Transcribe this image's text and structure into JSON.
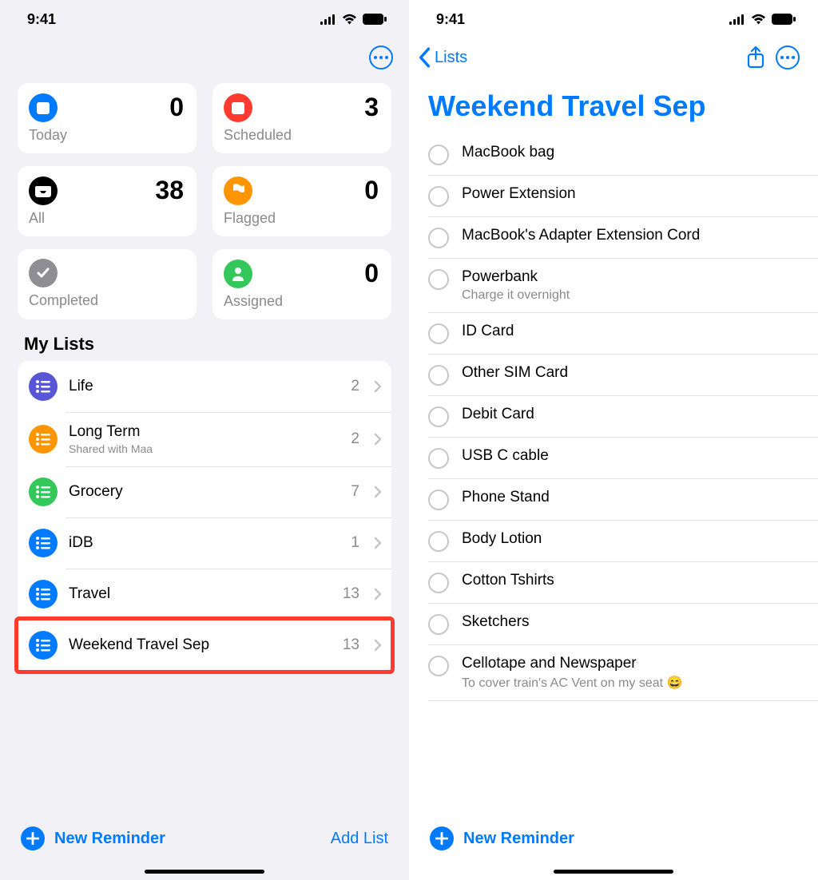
{
  "status": {
    "time": "9:41"
  },
  "left": {
    "cards": [
      {
        "label": "Today",
        "count": 0,
        "color": "#007aff",
        "icon": "calendar-icon"
      },
      {
        "label": "Scheduled",
        "count": 3,
        "color": "#ff3b30",
        "icon": "calendar-icon"
      },
      {
        "label": "All",
        "count": 38,
        "color": "#000000",
        "icon": "inbox-icon"
      },
      {
        "label": "Flagged",
        "count": 0,
        "color": "#ff9500",
        "icon": "flag-icon"
      },
      {
        "label": "Completed",
        "count": "",
        "color": "#8e8e93",
        "icon": "check-icon"
      },
      {
        "label": "Assigned",
        "count": 0,
        "color": "#34c759",
        "icon": "person-icon"
      }
    ],
    "section": "My Lists",
    "lists": [
      {
        "title": "Life",
        "subtitle": "",
        "count": 2,
        "color": "#5856d6"
      },
      {
        "title": "Long Term",
        "subtitle": "Shared with Maa",
        "count": 2,
        "color": "#ff9500"
      },
      {
        "title": "Grocery",
        "subtitle": "",
        "count": 7,
        "color": "#34c759"
      },
      {
        "title": "iDB",
        "subtitle": "",
        "count": 1,
        "color": "#007aff"
      },
      {
        "title": "Travel",
        "subtitle": "",
        "count": 13,
        "color": "#007aff"
      },
      {
        "title": "Weekend Travel Sep",
        "subtitle": "",
        "count": 13,
        "color": "#007aff"
      }
    ],
    "highlight_index": 5,
    "new_reminder": "New Reminder",
    "add_list": "Add List"
  },
  "right": {
    "back_label": "Lists",
    "title": "Weekend Travel Sep",
    "items": [
      {
        "title": "MacBook bag",
        "note": ""
      },
      {
        "title": "Power Extension",
        "note": ""
      },
      {
        "title": "MacBook's Adapter Extension Cord",
        "note": ""
      },
      {
        "title": "Powerbank",
        "note": "Charge it overnight"
      },
      {
        "title": "ID Card",
        "note": ""
      },
      {
        "title": "Other SIM Card",
        "note": ""
      },
      {
        "title": "Debit Card",
        "note": ""
      },
      {
        "title": "USB C cable",
        "note": ""
      },
      {
        "title": "Phone Stand",
        "note": ""
      },
      {
        "title": "Body Lotion",
        "note": ""
      },
      {
        "title": "Cotton Tshirts",
        "note": ""
      },
      {
        "title": "Sketchers",
        "note": ""
      },
      {
        "title": "Cellotape and Newspaper",
        "note": "To cover train's AC Vent on my seat 😄"
      }
    ],
    "new_reminder": "New Reminder"
  }
}
